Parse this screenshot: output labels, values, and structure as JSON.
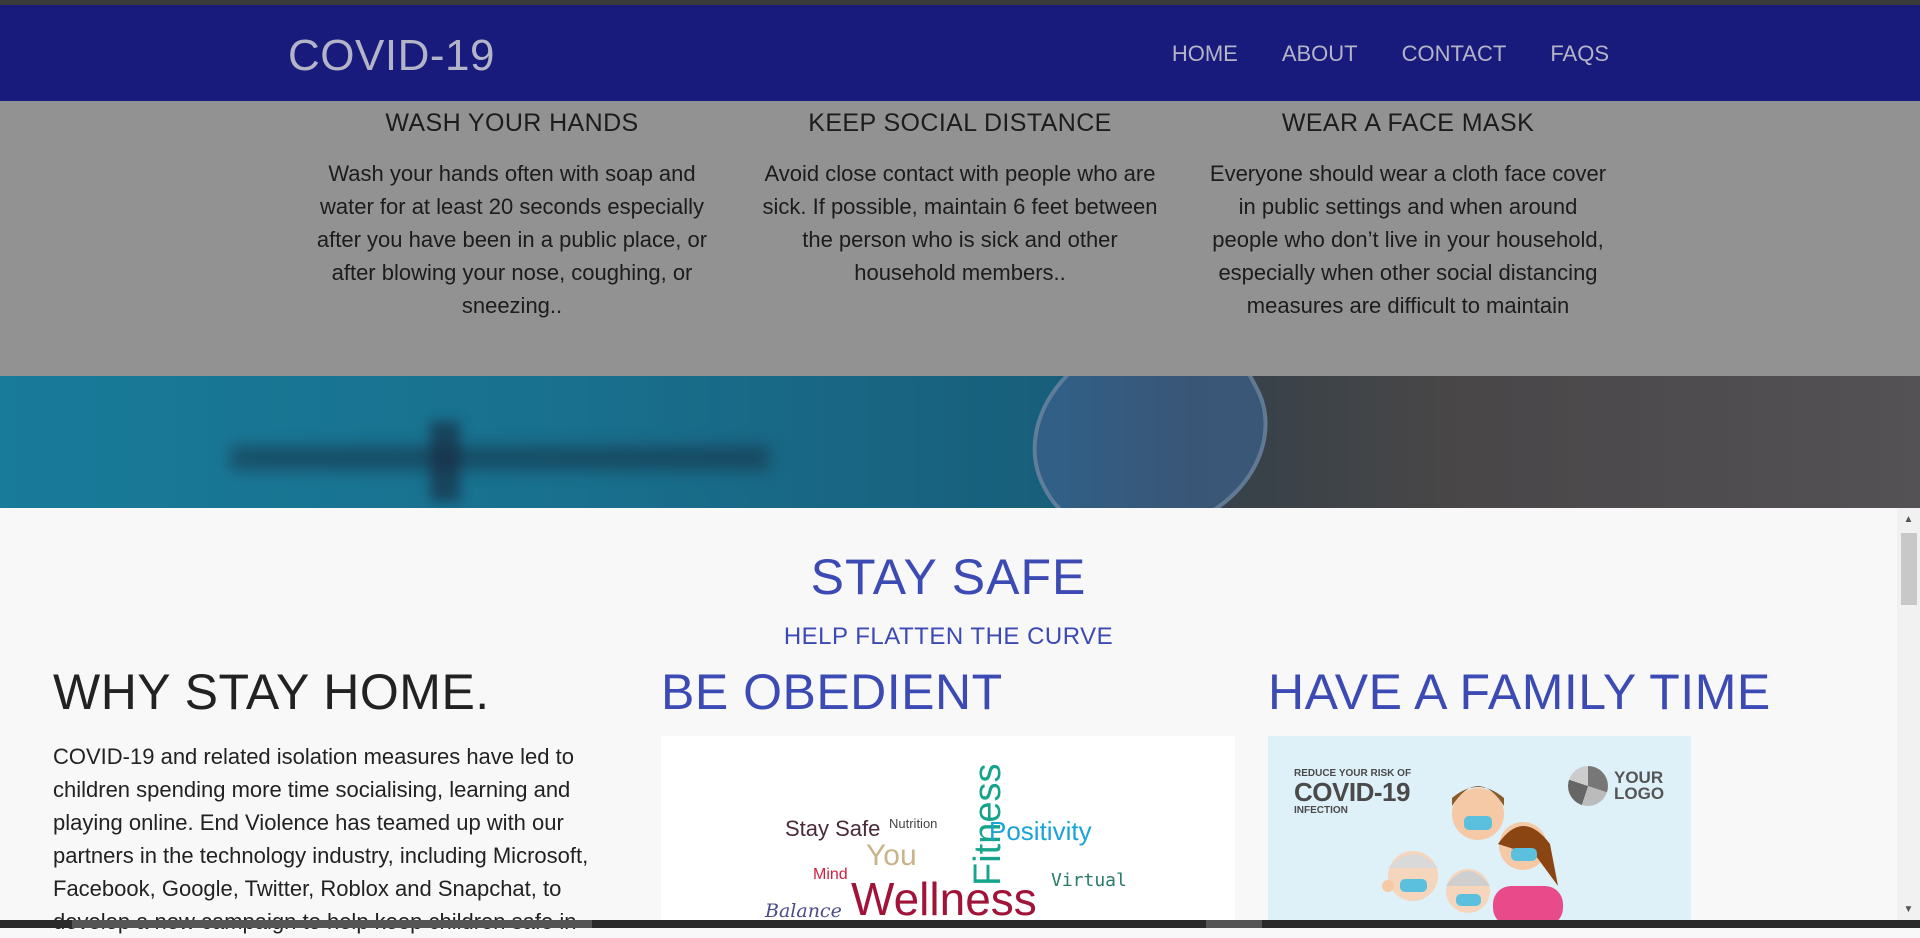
{
  "navbar": {
    "brand": "COVID-19",
    "items": [
      {
        "label": "HOME"
      },
      {
        "label": "ABOUT"
      },
      {
        "label": "CONTACT"
      },
      {
        "label": "FAQS"
      }
    ],
    "background": "#181a7c"
  },
  "tips": [
    {
      "title": "WASH YOUR HANDS",
      "text": "Wash your hands often with soap and water for at least 20 seconds especially after you have been in a public place, or after blowing your nose, coughing, or sneezing.."
    },
    {
      "title": "KEEP SOCIAL DISTANCE",
      "text": "Avoid close contact with people who are sick. If possible, maintain 6 feet between the person who is sick and other household members.."
    },
    {
      "title": "WEAR A FACE MASK",
      "text": "Everyone should wear a cloth face cover in public settings and when around people who don’t live in your household, especially when other social distancing measures are difficult to maintain"
    }
  ],
  "stay_safe": {
    "title": "STAY SAFE",
    "subtitle": "HELP FLATTEN THE CURVE",
    "accent": "#3c4ab4"
  },
  "columns": {
    "why": {
      "heading": "WHY STAY HOME.",
      "text": "COVID-19 and related isolation measures have led to children spending more time socialising, learning and playing online. End Violence has teamed up with our partners in the technology industry, including Microsoft, Facebook, Google, Twitter, Roblox and Snapchat, to develop a new campaign to help keep children safe in"
    },
    "obey": {
      "heading": "BE OBEDIENT",
      "words": [
        "Stay Safe",
        "Nutrition",
        "Fitness",
        "Positivity",
        "You",
        "Mind",
        "Wellness",
        "Virtual",
        "Balance"
      ]
    },
    "family": {
      "heading": "HAVE A FAMILY TIME",
      "poster_small": "REDUCE YOUR RISK OF",
      "poster_big": "COVID-19",
      "poster_tail": "INFECTION",
      "logo_line1": "YOUR",
      "logo_line2": "LOGO"
    }
  },
  "icons": {
    "scroll_up": "scroll-up-arrow-icon",
    "scroll_down": "scroll-down-arrow-icon"
  }
}
